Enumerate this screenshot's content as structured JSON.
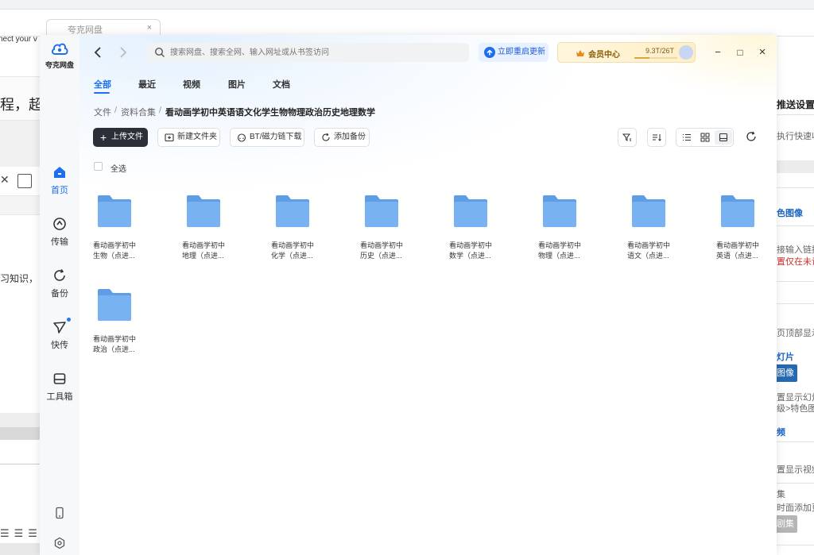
{
  "background": {
    "browser_tab_title": "夸克网盘",
    "browser_tab_close": "×",
    "left_text_1": "nect your v",
    "left_text_2": "程，超",
    "left_text_3": "习知识，",
    "right": {
      "push_settings": "推送设置",
      "line_1": "执行快速收录",
      "color_image": "色图像",
      "input_link": "接输入链接",
      "warn": "置仅在未设",
      "page_top": "页顶部显示",
      "slide": "灯片",
      "image_btn": "图像",
      "show_slide": "置显示幻灯",
      "path": "级>特色图像",
      "video": "频",
      "show_video": "置显示视频",
      "collection": "集",
      "add_more": "时面添加更",
      "collection_btn": "剧集"
    }
  },
  "app": {
    "logo_text": "夸克网盘",
    "sidebar": [
      {
        "label": "首页",
        "icon": "home-icon",
        "active": true
      },
      {
        "label": "传输",
        "icon": "transfer-icon",
        "active": false
      },
      {
        "label": "备份",
        "icon": "backup-icon",
        "active": false
      },
      {
        "label": "快传",
        "icon": "quick-send-icon",
        "active": false
      },
      {
        "label": "工具箱",
        "icon": "toolbox-icon",
        "active": false
      }
    ],
    "search_placeholder": "搜索网盘、搜索全网、输入网址或从书签访问",
    "update_label": "立即重启更新",
    "member_label": "会员中心",
    "quota_text": "9.3T/26T",
    "quota_fraction": 0.36,
    "window_controls": {
      "minimize": "−",
      "maximize": "□",
      "close": "×"
    },
    "tabs": [
      "全部",
      "最近",
      "视频",
      "图片",
      "文档"
    ],
    "breadcrumb": [
      "文件",
      "资料合集",
      "看动画学初中英语语文化学生物物理政治历史地理数学"
    ],
    "breadcrumb_sep": "/",
    "toolbar": {
      "upload": "上传文件",
      "new_folder": "新建文件夹",
      "bt": "BT/磁力链下载",
      "add_backup": "添加备份"
    },
    "select_all": "全选",
    "folders": [
      {
        "line1": "看动画学初中",
        "line2": "生物（点进..."
      },
      {
        "line1": "看动画学初中",
        "line2": "地理（点进..."
      },
      {
        "line1": "看动画学初中",
        "line2": "化学（点进..."
      },
      {
        "line1": "看动画学初中",
        "line2": "历史（点进..."
      },
      {
        "line1": "看动画学初中",
        "line2": "数学（点进..."
      },
      {
        "line1": "看动画学初中",
        "line2": "物理（点进..."
      },
      {
        "line1": "看动画学初中",
        "line2": "语文（点进..."
      },
      {
        "line1": "看动画学初中",
        "line2": "英语（点进..."
      },
      {
        "line1": "看动画学初中",
        "line2": "政治（点进..."
      }
    ],
    "colors": {
      "accent": "#1e6fef",
      "folder": "#79b2f0",
      "folder_tab": "#5f9ee6",
      "upload_bg": "#2b2f38"
    }
  }
}
